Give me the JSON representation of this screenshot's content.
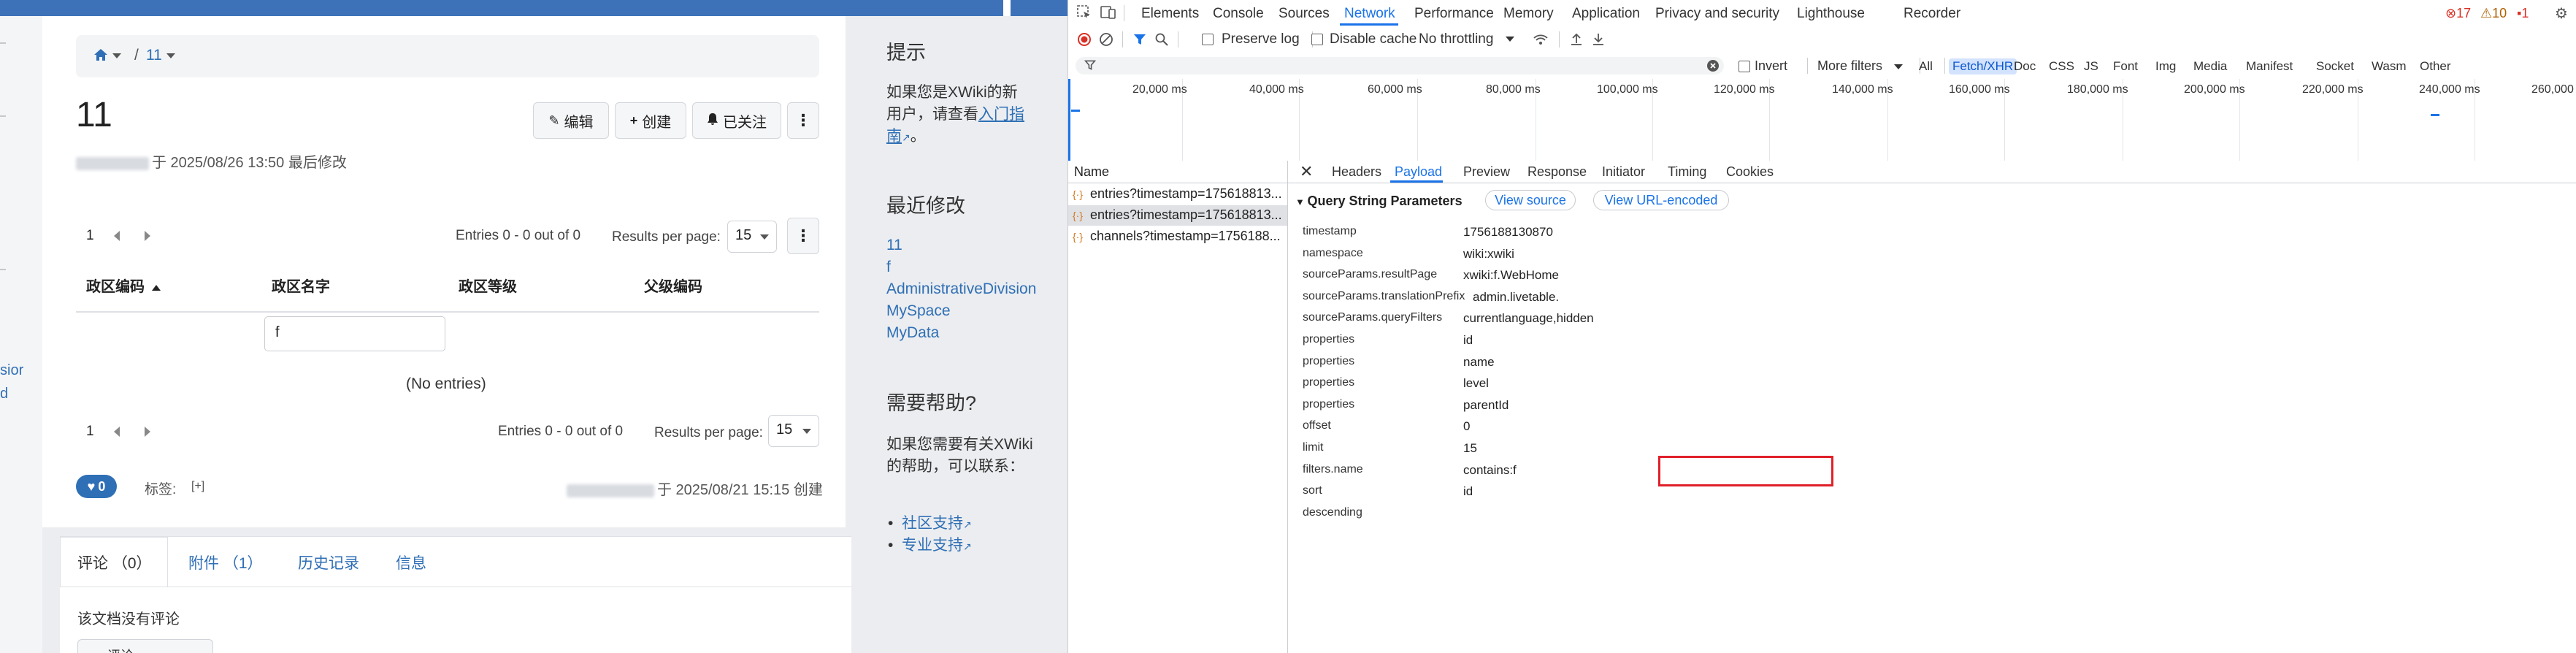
{
  "xwiki": {
    "breadcrumb": {
      "home_icon": "home-icon",
      "separator": "/",
      "page": "11"
    },
    "page_title": "11",
    "last_modified": "于 2025/08/26 13:50 最后修改",
    "actions": {
      "edit": "编辑",
      "create": "创建",
      "watching": "已关注"
    },
    "table_top": {
      "page": "1",
      "entries": "Entries 0 - 0 out of 0",
      "results_label": "Results per page:",
      "results_value": "15"
    },
    "columns": [
      "政区编码",
      "政区名字",
      "政区等级",
      "父级编码"
    ],
    "filter_value": "f",
    "no_entries": "(No entries)",
    "table_bottom": {
      "page": "1",
      "entries": "Entries 0 - 0 out of 0",
      "results_label": "Results per page:",
      "results_value": "15"
    },
    "likes": "0",
    "tags_label": "标签:",
    "tags_add": "[+]",
    "created": "于 2025/08/21 15:15 创建",
    "left_sliver": {
      "text1": "sior",
      "text2": "d"
    },
    "tabs": [
      {
        "label": "评论 （0）",
        "active": true
      },
      {
        "label": "附件 （1）",
        "active": false
      },
      {
        "label": "历史记录",
        "active": false
      },
      {
        "label": "信息",
        "active": false
      }
    ],
    "no_comments": "该文档没有评论",
    "comment_button": "评论",
    "right_panel": {
      "tips_title": "提示",
      "tips_text": "如果您是XWiki的新用户，请查看",
      "tips_link_part1": "入门指",
      "tips_link_part2": "南",
      "tips_end": "。",
      "recent_title": "最近修改",
      "recent_links": [
        "11",
        "f",
        "AdministrativeDivision",
        "MySpace",
        "MyData"
      ],
      "help_title": "需要帮助?",
      "help_text": "如果您需要有关XWiki的帮助，可以联系：",
      "help_links": [
        "社区支持",
        "专业支持"
      ]
    }
  },
  "devtools": {
    "tabs": [
      "Elements",
      "Console",
      "Sources",
      "Network",
      "Performance",
      "Memory",
      "Application",
      "Privacy and security",
      "Lighthouse",
      "Recorder"
    ],
    "active_tab": "Network",
    "errors": "17",
    "warnings": "10",
    "issues": "1",
    "toolbar": {
      "preserve_log": "Preserve log",
      "disable_cache": "Disable cache",
      "throttling": "No throttling"
    },
    "filter": {
      "icon": "filter-icon",
      "invert": "Invert",
      "more_filters": "More filters"
    },
    "filter_types": [
      "All",
      "Fetch/XHR",
      "Doc",
      "CSS",
      "JS",
      "Font",
      "Img",
      "Media",
      "Manifest",
      "Socket",
      "Wasm",
      "Other"
    ],
    "selected_filter": "Fetch/XHR",
    "timeline_labels": [
      "20,000 ms",
      "40,000 ms",
      "60,000 ms",
      "80,000 ms",
      "100,000 ms",
      "120,000 ms",
      "140,000 ms",
      "160,000 ms",
      "180,000 ms",
      "200,000 ms",
      "220,000 ms",
      "240,000 ms",
      "260,000"
    ],
    "name_header": "Name",
    "requests": [
      {
        "name": "entries?timestamp=175618813...",
        "selected": false
      },
      {
        "name": "entries?timestamp=175618813...",
        "selected": true
      },
      {
        "name": "channels?timestamp=1756188...",
        "selected": false
      }
    ],
    "detail_tabs": [
      "Headers",
      "Payload",
      "Preview",
      "Response",
      "Initiator",
      "Timing",
      "Cookies"
    ],
    "active_detail_tab": "Payload",
    "qsp_title": "Query String Parameters",
    "view_source": "View source",
    "view_url_encoded": "View URL-encoded",
    "params": [
      {
        "key": "timestamp",
        "value": "1756188130870"
      },
      {
        "key": "namespace",
        "value": "wiki:xwiki"
      },
      {
        "key": "sourceParams.resultPage",
        "value": "xwiki:f.WebHome"
      },
      {
        "key": "sourceParams.translationPrefix",
        "value": "admin.livetable."
      },
      {
        "key": "sourceParams.queryFilters",
        "value": "currentlanguage,hidden"
      },
      {
        "key": "properties",
        "value": "id"
      },
      {
        "key": "properties",
        "value": "name"
      },
      {
        "key": "properties",
        "value": "level"
      },
      {
        "key": "properties",
        "value": "parentId"
      },
      {
        "key": "offset",
        "value": "0"
      },
      {
        "key": "limit",
        "value": "15"
      },
      {
        "key": "filters.name",
        "value": "contains:f"
      },
      {
        "key": "sort",
        "value": "id"
      },
      {
        "key": "descending",
        "value": ""
      }
    ],
    "colors": {
      "accent": "#1a73e8",
      "highlight": "#e0202a",
      "xwiki_blue": "#3d72b8"
    }
  }
}
